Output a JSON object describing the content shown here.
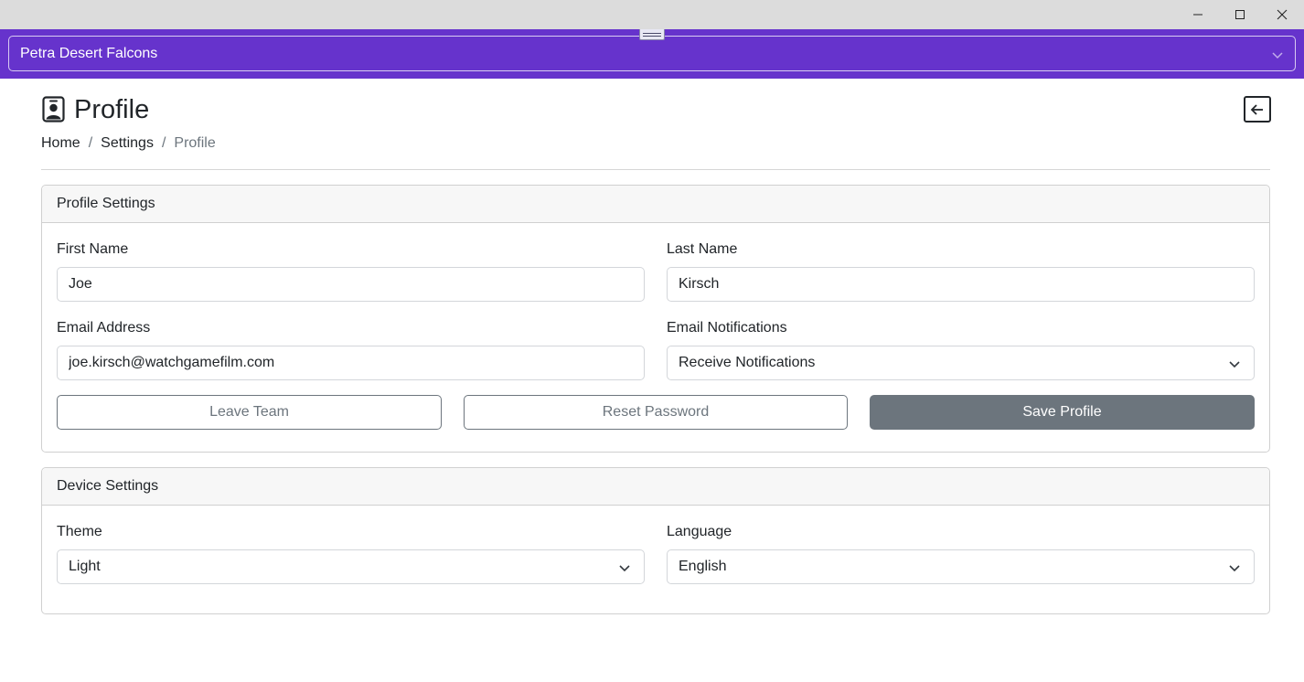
{
  "window": {
    "minimize_icon": "minimize-icon",
    "maximize_icon": "maximize-icon",
    "close_icon": "close-icon"
  },
  "team_selector": {
    "value": "Petra Desert Falcons",
    "accent_color": "#6633cc"
  },
  "header": {
    "icon": "person-badge-icon",
    "title": "Profile",
    "back_icon": "arrow-left-square-icon"
  },
  "breadcrumb": {
    "items": [
      "Home",
      "Settings",
      "Profile"
    ],
    "separator": "/"
  },
  "profile_settings": {
    "title": "Profile Settings",
    "first_name": {
      "label": "First Name",
      "value": "Joe"
    },
    "last_name": {
      "label": "Last Name",
      "value": "Kirsch"
    },
    "email": {
      "label": "Email Address",
      "value": "joe.kirsch@watchgamefilm.com"
    },
    "notifications": {
      "label": "Email Notifications",
      "value": "Receive Notifications"
    },
    "buttons": {
      "leave_team": "Leave Team",
      "reset_password": "Reset Password",
      "save_profile": "Save Profile"
    }
  },
  "device_settings": {
    "title": "Device Settings",
    "theme": {
      "label": "Theme",
      "value": "Light"
    },
    "language": {
      "label": "Language",
      "value": "English"
    }
  }
}
